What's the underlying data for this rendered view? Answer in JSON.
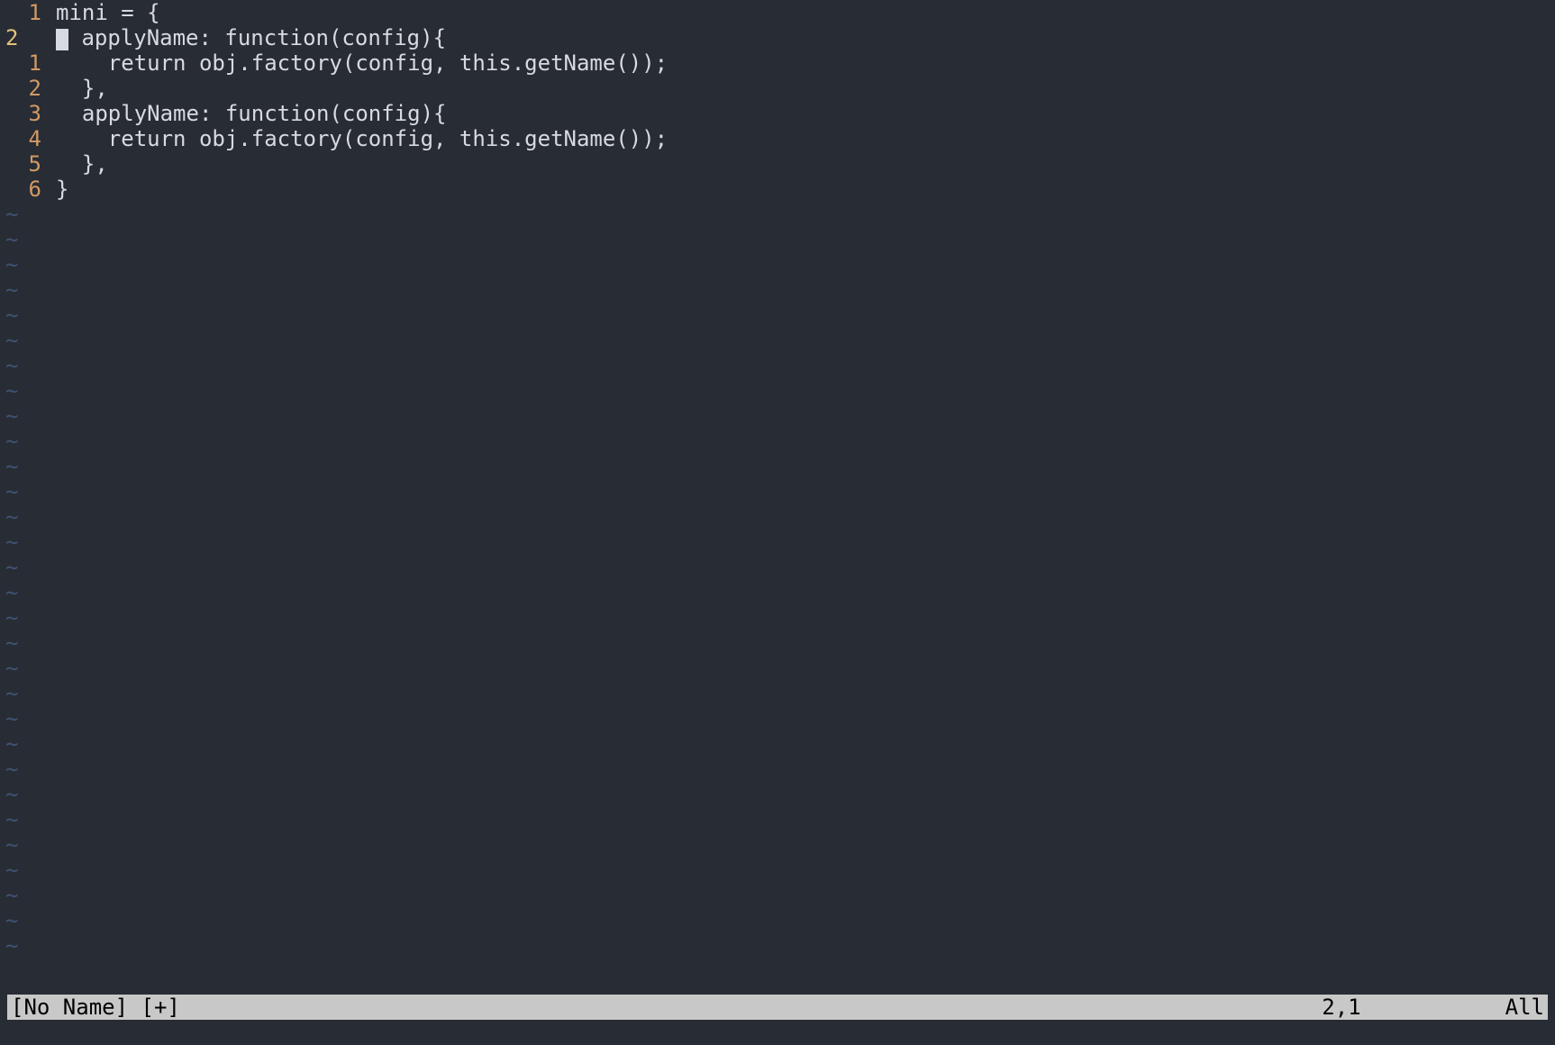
{
  "editor": {
    "lines": [
      {
        "rel": "1",
        "current": false,
        "cursor": false,
        "text": "mini = {"
      },
      {
        "rel": "2",
        "current": true,
        "cursor": true,
        "text": " applyName: function(config){"
      },
      {
        "rel": "1",
        "current": false,
        "cursor": false,
        "text": "    return obj.factory(config, this.getName());"
      },
      {
        "rel": "2",
        "current": false,
        "cursor": false,
        "text": "  },"
      },
      {
        "rel": "3",
        "current": false,
        "cursor": false,
        "text": "  applyName: function(config){"
      },
      {
        "rel": "4",
        "current": false,
        "cursor": false,
        "text": "    return obj.factory(config, this.getName());"
      },
      {
        "rel": "5",
        "current": false,
        "cursor": false,
        "text": "  },"
      },
      {
        "rel": "6",
        "current": false,
        "cursor": false,
        "text": "}"
      }
    ],
    "tilde": "~",
    "tilde_count": 30
  },
  "status": {
    "file": "[No Name] [+]",
    "pos": "2,1",
    "view": "All"
  },
  "colors": {
    "bg": "#282c34",
    "fg": "#d7dae0",
    "gutter_rel": "#d19a66",
    "gutter_cur": "#e5c07b",
    "tilde": "#3f5273",
    "status_bg": "#c8c8c8",
    "status_fg": "#000000"
  }
}
